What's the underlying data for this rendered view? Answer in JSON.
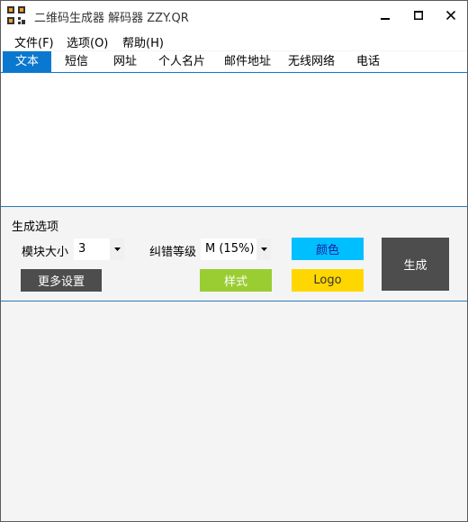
{
  "window": {
    "title": "二维码生成器 解码器 ZZY.QR",
    "controls": {
      "minimize": "minimize-icon",
      "maximize": "maximize-icon",
      "close": "close-icon"
    }
  },
  "menu": [
    {
      "label": "文件(F)"
    },
    {
      "label": "选项(O)"
    },
    {
      "label": "帮助(H)"
    }
  ],
  "tabs": [
    {
      "label": "文本",
      "active": true
    },
    {
      "label": "短信"
    },
    {
      "label": "网址"
    },
    {
      "label": "个人名片"
    },
    {
      "label": "邮件地址"
    },
    {
      "label": "无线网络"
    },
    {
      "label": "电话"
    }
  ],
  "text_input": {
    "value": ""
  },
  "options": {
    "section_title": "生成选项",
    "module_size": {
      "label": "模块大小",
      "value": "3"
    },
    "error_level": {
      "label": "纠错等级",
      "value": "M (15%)"
    },
    "buttons": {
      "color": "颜色",
      "generate": "生成",
      "more": "更多设置",
      "style": "样式",
      "logo": "Logo"
    }
  },
  "colors": {
    "accent": "#0b78d0",
    "color_button": "#00bfff",
    "style_button": "#9acd32",
    "logo_button": "#ffd700",
    "generate_button": "#4d4d4d",
    "more_button": "#4d4d4d"
  }
}
